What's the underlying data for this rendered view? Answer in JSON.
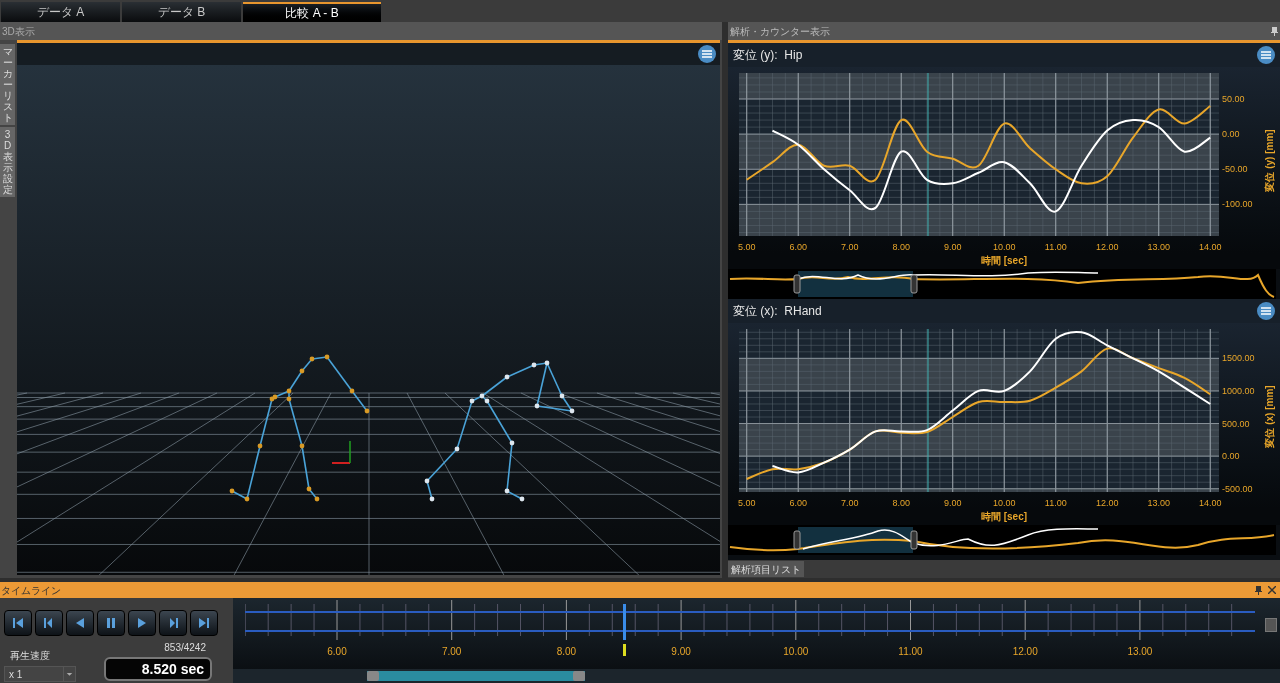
{
  "tabs": [
    {
      "label": "データ A",
      "selected": false
    },
    {
      "label": "データ B",
      "selected": false
    },
    {
      "label": "比較 A - B",
      "selected": true
    }
  ],
  "view3d": {
    "title": "3D表示",
    "side_tabs": [
      "マーカーリスト",
      "3D表示設定"
    ]
  },
  "analysis": {
    "title": "解析・カウンター表示",
    "bottom_tab": "解析項目リスト",
    "charts": [
      {
        "title": "変位 (y):  Hip",
        "chart_data": {
          "type": "line",
          "xlabel": "時間 [sec]",
          "ylabel": "変位 (y) [mm]",
          "x": [
            5.0,
            5.5,
            6.0,
            6.5,
            7.0,
            7.5,
            8.0,
            8.5,
            9.0,
            9.5,
            10.0,
            10.5,
            11.0,
            11.5,
            12.0,
            12.5,
            13.0,
            13.5,
            14.0
          ],
          "xlim": [
            4.85,
            14.17
          ],
          "ylim": [
            -145,
            87
          ],
          "series": [
            {
              "color": "#e8a62a",
              "values": [
                -65,
                -40,
                -15,
                -45,
                -45,
                -65,
                20,
                -25,
                -35,
                -45,
                15,
                -20,
                -50,
                -70,
                -60,
                -5,
                35,
                15,
                40
              ]
            },
            {
              "color": "#ffffff",
              "values": [
                null,
                5,
                -15,
                -50,
                -80,
                -105,
                -25,
                -65,
                -70,
                -55,
                -40,
                -70,
                -110,
                -45,
                5,
                20,
                10,
                -25,
                -5
              ]
            }
          ],
          "xticks": [
            {
              "value": 5,
              "label": "5.00"
            },
            {
              "value": 6,
              "label": "6.00"
            },
            {
              "value": 7,
              "label": "7.00"
            },
            {
              "value": 8,
              "label": "8.00"
            },
            {
              "value": 9,
              "label": "9.00"
            },
            {
              "value": 10,
              "label": "10.00"
            },
            {
              "value": 11,
              "label": "11.00"
            },
            {
              "value": 12,
              "label": "12.00"
            },
            {
              "value": 13,
              "label": "13.00"
            },
            {
              "value": 14,
              "label": "14.00"
            }
          ],
          "yticks": [
            {
              "value": -100,
              "label": "-100.00"
            },
            {
              "value": -50,
              "label": "-50.00"
            },
            {
              "value": 0,
              "label": "0.00"
            },
            {
              "value": 50,
              "label": "50.00"
            }
          ],
          "grid": true,
          "ref_lines": [
            {
              "axis": "x",
              "value": 8.52,
              "color": "#3fb0b0"
            }
          ]
        }
      },
      {
        "title": "変位 (x):  RHand",
        "chart_data": {
          "type": "line",
          "xlabel": "時間 [sec]",
          "ylabel": "変位 (x) [mm]",
          "x": [
            5.0,
            5.5,
            6.0,
            6.5,
            7.0,
            7.5,
            8.0,
            8.5,
            9.0,
            9.5,
            10.0,
            10.5,
            11.0,
            11.5,
            12.0,
            12.5,
            13.0,
            13.5,
            14.0
          ],
          "xlim": [
            4.85,
            14.17
          ],
          "ylim": [
            -550,
            1950
          ],
          "series": [
            {
              "color": "#e8a62a",
              "values": [
                -350,
                -200,
                -200,
                -100,
                100,
                380,
                360,
                370,
                600,
                830,
                830,
                850,
                1050,
                1300,
                1650,
                1500,
                1350,
                1200,
                950
              ]
            },
            {
              "color": "#ffffff",
              "values": [
                null,
                -150,
                -250,
                -100,
                100,
                380,
                380,
                400,
                700,
                1000,
                1000,
                1300,
                1800,
                1900,
                1700,
                1500,
                1300,
                1050,
                800
              ]
            }
          ],
          "xticks": [
            {
              "value": 5,
              "label": "5.00"
            },
            {
              "value": 6,
              "label": "6.00"
            },
            {
              "value": 7,
              "label": "7.00"
            },
            {
              "value": 8,
              "label": "8.00"
            },
            {
              "value": 9,
              "label": "9.00"
            },
            {
              "value": 10,
              "label": "10.00"
            },
            {
              "value": 11,
              "label": "11.00"
            },
            {
              "value": 12,
              "label": "12.00"
            },
            {
              "value": 13,
              "label": "13.00"
            },
            {
              "value": 14,
              "label": "14.00"
            }
          ],
          "yticks": [
            {
              "value": -500,
              "label": "-500.00"
            },
            {
              "value": 0,
              "label": "0.00"
            },
            {
              "value": 500,
              "label": "500.00"
            },
            {
              "value": 1000,
              "label": "1000.00"
            },
            {
              "value": 1500,
              "label": "1500.00"
            }
          ],
          "grid": true,
          "ref_lines": [
            {
              "axis": "x",
              "value": 8.52,
              "color": "#3fb0b0"
            }
          ]
        }
      }
    ]
  },
  "timeline": {
    "title": "タイムライン",
    "speed_label": "再生速度",
    "speed": "x 1",
    "frame": "853/4242",
    "time": "8.520 sec",
    "ticks": [
      "6.00",
      "7.00",
      "8.00",
      "9.00",
      "10.00",
      "11.00",
      "12.00",
      "13.00"
    ],
    "playhead": {
      "level": 0.377
    }
  }
}
